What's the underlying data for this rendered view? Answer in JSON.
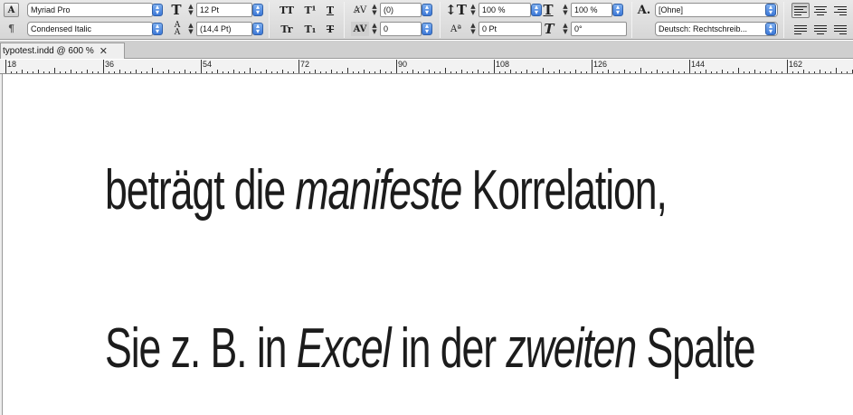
{
  "control_panel": {
    "mode_char": "A",
    "para_char": "¶",
    "font_family": "Myriad Pro",
    "font_style": "Condensed Italic",
    "font_size": "12 Pt",
    "leading": "(14,4 Pt)",
    "kerning": "(0)",
    "tracking": "0",
    "vertical_scale": "100 %",
    "horizontal_scale": "100 %",
    "baseline_shift": "0 Pt",
    "skew": "0°",
    "char_style": "[Ohne]",
    "language": "Deutsch: Rechtschreib...",
    "style_buttons": [
      "TT",
      "T¹",
      "T",
      "Tr",
      "T₁",
      "T"
    ]
  },
  "document_tab": {
    "title": "typotest.indd @ 600 %"
  },
  "ruler": {
    "labels": [
      "18",
      "36",
      "54",
      "72",
      "90",
      "108",
      "126",
      "144",
      "162"
    ]
  },
  "document": {
    "line1": {
      "before": "beträgt die ",
      "italic": "manifeste",
      "after": " Korrelation,"
    },
    "line2": {
      "before": "Sie z. B. in ",
      "italic1": "Excel",
      "middle": " in der ",
      "italic2": "zweiten",
      "after": " Spalte"
    }
  }
}
